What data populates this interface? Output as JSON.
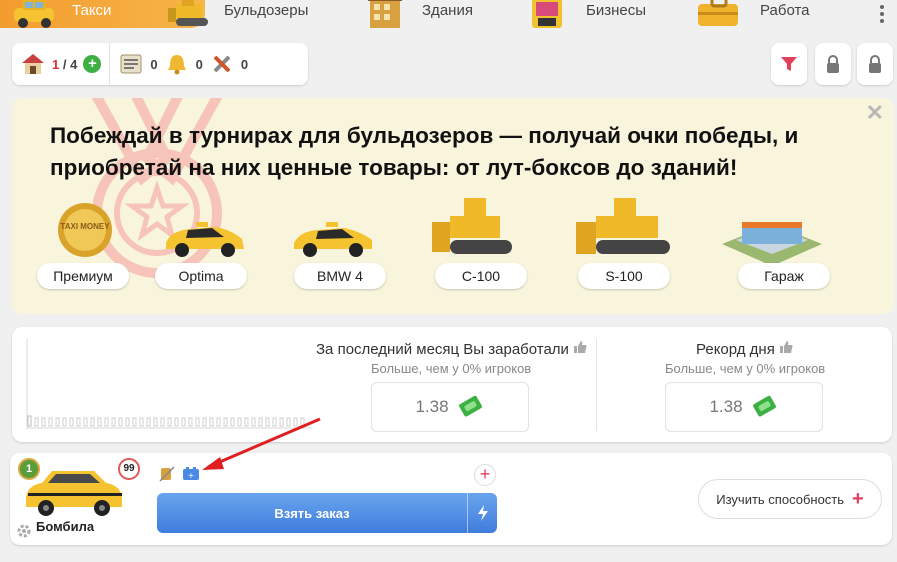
{
  "tabs": [
    {
      "label": "Такси",
      "icon": "taxi-icon",
      "active": true
    },
    {
      "label": "Бульдозеры",
      "icon": "bulldozer-icon"
    },
    {
      "label": "Здания",
      "icon": "building-icon"
    },
    {
      "label": "Бизнесы",
      "icon": "business-icon"
    },
    {
      "label": "Работа",
      "icon": "work-icon"
    }
  ],
  "stats": {
    "garage_current": "1",
    "garage_sep": "/",
    "garage_total": "4",
    "documents": "0",
    "bells": "0",
    "tools": "0"
  },
  "banner": {
    "title": "Побеждай в турнирах для бульдозеров — получай очки победы, и приобретай на них ценные товары: от лут-боксов до зданий!",
    "coin_text": "TAXI MONEY",
    "prizes": [
      "Премиум",
      "Optima",
      "BMW 4",
      "C-100",
      "S-100",
      "Гараж"
    ]
  },
  "earnings": {
    "month_title": "За последний месяц Вы заработали",
    "month_sub": "Больше, чем у 0% игроков",
    "month_value": "1.38",
    "record_title": "Рекорд дня",
    "record_sub": "Больше, чем у 0% игроков",
    "record_value": "1.38"
  },
  "car": {
    "level": "1",
    "hp": "99",
    "name": "Бомбила",
    "take_order": "Взять заказ",
    "study": "Изучить способность"
  },
  "colors": {
    "accent_orange": "#f39c2e",
    "button_blue": "#4a89e4",
    "plus_red": "#e0405a",
    "money_green": "#3cb043"
  }
}
